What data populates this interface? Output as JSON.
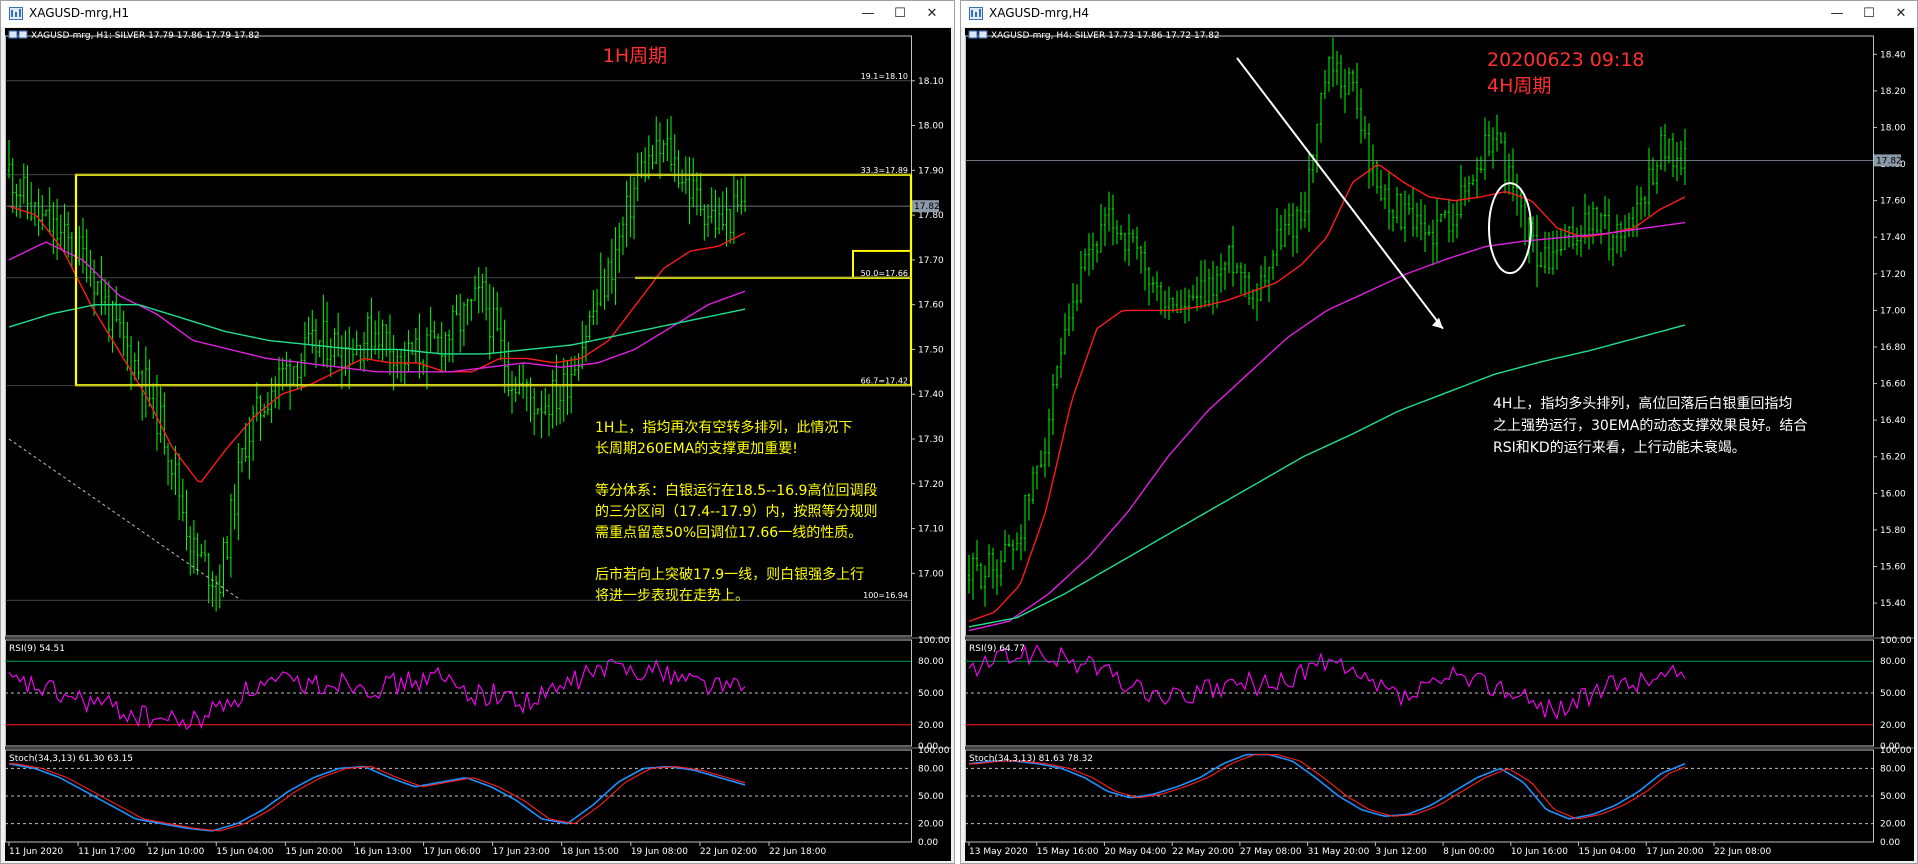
{
  "windows": [
    {
      "title": "XAGUSD-mrg,H1",
      "info": "XAGUSD-mrg, H1:  SILVER   17.79  17.86  17.79  17.82",
      "overlay_title": "1H周期",
      "price_ticks": [
        "18.10",
        "18.00",
        "17.90",
        "17.80",
        "17.70",
        "17.60",
        "17.50",
        "17.40",
        "17.30",
        "17.20",
        "17.10",
        "17.00"
      ],
      "current_price": "17.82",
      "fib_labels": [
        "19.1=18.10",
        "33.3=17.89",
        "50.0=17.66",
        "66.7=17.42",
        "100=16.94"
      ],
      "annotation": [
        "1H上，指均再次有空转多排列，此情况下",
        "长周期260EMA的支撑更加重要!",
        "",
        "等分体系：白银运行在18.5--16.9高位回调段",
        "的三分区间（17.4--17.9）内，按照等分规则",
        "需重点留意50%回调位17.66一线的性质。",
        "",
        "后市若向上突破17.9一线，则白银强多上行",
        "将进一步表现在走势上。"
      ],
      "rsi_label": "RSI(9) 54.51",
      "rsi_ticks": [
        "100.00",
        "80.00",
        "50.00",
        "20.00",
        "0.00"
      ],
      "stoch_label": "Stoch(34,3,13) 61.30 63.15",
      "stoch_ticks": [
        "100.00",
        "80.00",
        "50.00",
        "20.00",
        "0.00"
      ],
      "time_labels": [
        "11 Jun 2020",
        "11 Jun 17:00",
        "12 Jun 10:00",
        "15 Jun 04:00",
        "15 Jun 20:00",
        "16 Jun 13:00",
        "17 Jun 06:00",
        "17 Jun 23:00",
        "18 Jun 15:00",
        "19 Jun 08:00",
        "22 Jun 02:00",
        "22 Jun 18:00"
      ]
    },
    {
      "title": "XAGUSD-mrg,H4",
      "info": "XAGUSD-mrg, H4:  SILVER   17.73  17.86  17.72  17.82",
      "overlay_title": "20200623 09:18",
      "overlay_subtitle": "4H周期",
      "price_ticks": [
        "18.40",
        "18.20",
        "18.00",
        "17.80",
        "17.60",
        "17.40",
        "17.20",
        "17.00",
        "16.80",
        "16.60",
        "16.40",
        "16.20",
        "16.00",
        "15.80",
        "15.60",
        "15.40"
      ],
      "current_price": "17.82",
      "annotation": [
        "4H上，指均多头排列，高位回落后白银重回指均",
        "之上强势运行，30EMA的动态支撑效果良好。结合",
        "RSI和KD的运行来看，上行动能未衰竭。"
      ],
      "rsi_label": "RSI(9) 64.77",
      "rsi_ticks": [
        "100.00",
        "80.00",
        "50.00",
        "20.00",
        "0.00"
      ],
      "stoch_label": "Stoch(34,3,13) 81.63 78.32",
      "stoch_ticks": [
        "100.00",
        "80.00",
        "50.00",
        "20.00",
        "0.00"
      ],
      "time_labels": [
        "13 May 2020",
        "15 May 16:00",
        "20 May 04:00",
        "22 May 20:00",
        "27 May 08:00",
        "31 May 20:00",
        "3 Jun 12:00",
        "8 Jun 00:00",
        "10 Jun 16:00",
        "15 Jun 04:00",
        "17 Jun 20:00",
        "22 Jun 08:00"
      ]
    }
  ],
  "colors": {
    "bg": "#000000",
    "candles": "#00ff00",
    "ema_fast": "#ff1a1a",
    "ema_mid": "#e020e0",
    "ema_slow": "#20e090",
    "fib_box": "#ffff00",
    "annotation_h1": "#ffff00",
    "annotation_h4": "#ffffff",
    "title_red": "#ff3030",
    "rsi": "#ff00ff",
    "stoch_main": "#1e90ff",
    "stoch_signal": "#ff2020"
  }
}
